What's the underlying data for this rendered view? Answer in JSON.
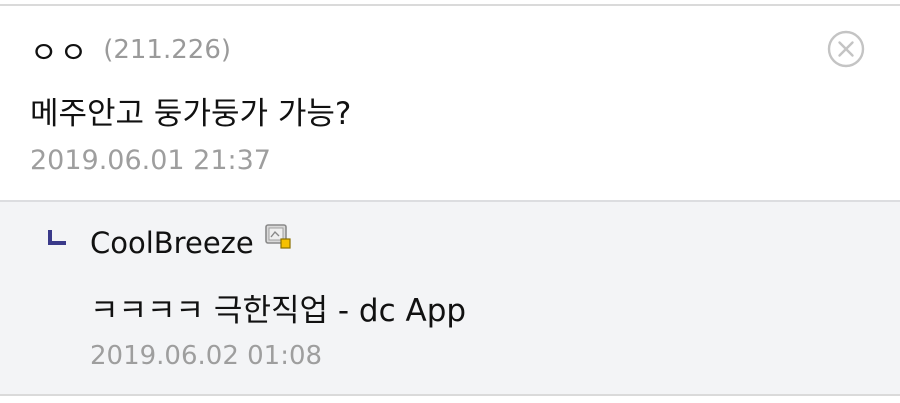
{
  "comment": {
    "nickname": "ㅇㅇ",
    "ip": "(211.226)",
    "body": "메주안고 둥가둥가 가능?",
    "timestamp": "2019.06.01 21:37",
    "delete_icon": "close-circle-icon"
  },
  "reply": {
    "reply_icon": "reply-arrow-icon",
    "nickname": "CoolBreeze",
    "member_icon": "fixed-nick-icon",
    "body": "ㅋㅋㅋㅋ 극한직업 - dc App",
    "timestamp": "2019.06.02 01:08"
  },
  "colors": {
    "reply_background": "#f3f4f6",
    "reply_arrow": "#3a3a8a",
    "divider": "#dadada"
  }
}
